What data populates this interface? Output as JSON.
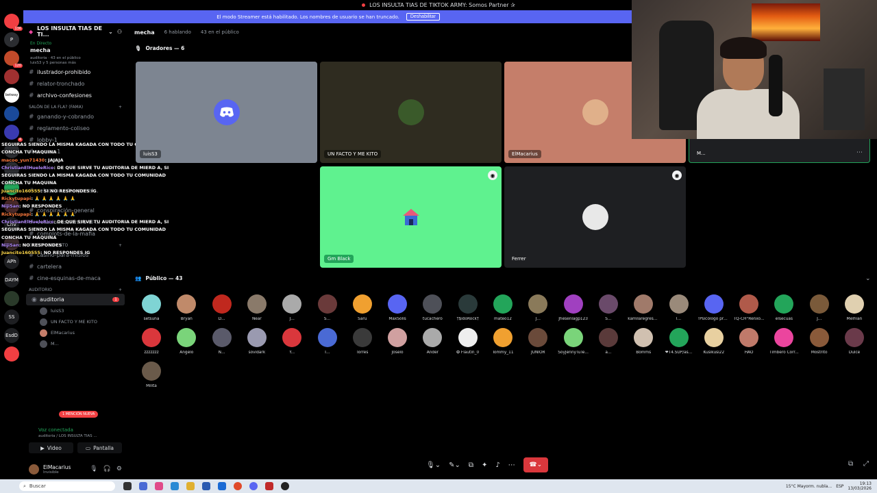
{
  "window": {
    "title": "LOS INSULTA TIAS DE TIKTOK ARMY: Somos Partner ✰"
  },
  "streamer_banner": {
    "text": "El modo Streamer está habilitado. Los nombres de usuario se han truncado.",
    "button": "Deshabilitar"
  },
  "rail": {
    "items": [
      {
        "label": "NUEVO",
        "badge": "136"
      },
      {
        "label": "P",
        "badge": ""
      },
      {
        "label": "",
        "badge": "120"
      },
      {
        "label": "",
        "badge": ""
      },
      {
        "label": "betway",
        "badge": ""
      },
      {
        "label": "",
        "badge": ""
      },
      {
        "label": "",
        "badge": "4"
      },
      {
        "label": "",
        "badge": ""
      }
    ]
  },
  "sidebar": {
    "server_name": "LOS INSULTA TIAS DE TI...",
    "live": {
      "tag": "En Directo",
      "name": "mecha",
      "meta1": "auditoria · 43 en el público",
      "meta2": "luisS3 y 5 personas más"
    },
    "channels_top": [
      {
        "label": "ilustrador-prohibido",
        "bright": true
      },
      {
        "label": "relator-tronchado",
        "bright": false
      },
      {
        "label": "archivo-confesiones",
        "bright": true
      }
    ],
    "category_fama": "SALÓN DE LA FLA? (FAMA)",
    "channels_fama": [
      {
        "label": "ganando-y-cobrando"
      },
      {
        "label": "reglamento-coliseo"
      },
      {
        "label": "lobby-1"
      },
      {
        "label": "versus-1"
      },
      {
        "label": "seleccionados-por-el..."
      }
    ],
    "channels_mid": [
      {
        "label": "conspiración-general"
      },
      {
        "label": "votaciones-contra-el-..."
      },
      {
        "label": "complots-de-la-mafia"
      }
    ],
    "category_ent": "ENTRETENIMIENTO",
    "channels_ent": [
      {
        "label": "casino-para-misios"
      },
      {
        "label": "cartelera"
      },
      {
        "label": "cine-esquinas-de-maca"
      }
    ],
    "category_aud": "AUDITORIO",
    "voice_channel": {
      "label": "auditoria",
      "sub": "mecha",
      "count": "1"
    },
    "voice_users": [
      "luisS3",
      "UN FACTO Y ME KITO",
      "ElMacarius",
      "M..."
    ],
    "mention_badge": "1 MENCIÓN NUEVA"
  },
  "voice_bar": {
    "status": "Voz conectada",
    "path": "auditoria / LOS INSULTA TIAS ...",
    "video": "Video",
    "screen": "Pantalla"
  },
  "user_bar": {
    "name": "ElMacarius",
    "status": "Invisible"
  },
  "chat_overlay": [
    {
      "user": "",
      "text": "SEGUIRAS SIENDO LA MISMA KAGADA CON TODO TU COMUNIDAD CONCHA TU MAQUINA"
    },
    {
      "user": "macoo_yun71430",
      "text": ": JAJAJA"
    },
    {
      "user": "ChristianElHueleRico",
      "text": ": DE QUE SIRVE TU AUDITORIA DE MIERD A, SI SEGUIRAS SIENDO LA MISMA KAGADA CON TODO TU COMUNIDAD CONCHA TU MAQUINA"
    },
    {
      "user": "Juancito160555",
      "text": ": SI NO RESPONDES IG"
    },
    {
      "user": "Rickytupapi",
      "text": ": 🙏 🙏 🙏 🙏 🙏 🙏"
    },
    {
      "user": "NijiSan",
      "text": ": NO RESPONDES"
    },
    {
      "user": "Rickytupapi",
      "text": ": 🙏 🙏 🙏 🙏 🙏 🙏"
    },
    {
      "user": "ChristianElHueleRico",
      "text": ": DE QUE SIRVE TU AUDITORIA DE MIERD A, SI SEGUIRAS SIENDO LA MISMA KAGADA CON TODO TU COMUNIDAD CONCHA TU MAQUINA"
    },
    {
      "user": "NijiSan",
      "text": ": NO RESPONDES"
    },
    {
      "user": "Juancito160555",
      "text": ": NO RESPONDES IG"
    }
  ],
  "main": {
    "channel": "mecha",
    "talking": "6 hablando",
    "audience_count": "43 en el público",
    "speakers_title": "Oradores — 6",
    "public_title": "Público — 43",
    "speakers": [
      {
        "label": "luisS3",
        "color": "#7d8591",
        "icon": "discord"
      },
      {
        "label": "UN FACTO Y ME KITO",
        "color": "#2f2c20",
        "icon": "avatar"
      },
      {
        "label": "ElMacarius",
        "color": "#c57e6a",
        "icon": "avatar"
      },
      {
        "label": "M...",
        "color": "#1e1f22",
        "icon": ""
      },
      {
        "label": "Gm Black",
        "color": "#5ff28f",
        "icon": "house"
      },
      {
        "label": "Ferrer",
        "color": "#1e1f22",
        "icon": "avatar"
      }
    ],
    "audience": [
      {
        "name": "setsuna",
        "color": "#7fd4d4"
      },
      {
        "name": "Bryan",
        "color": "#c08a6a"
      },
      {
        "name": "D...",
        "color": "#c0281e"
      },
      {
        "name": "Near",
        "color": "#8a7a6a"
      },
      {
        "name": "J...",
        "color": "#aaaaaa"
      },
      {
        "name": "S...",
        "color": "#6a3a3a"
      },
      {
        "name": "Saru",
        "color": "#f0a030"
      },
      {
        "name": "MaxSolis",
        "color": "#5865f2"
      },
      {
        "name": "tucachero",
        "color": "#4e5058"
      },
      {
        "name": "†$idoRock†",
        "color": "#2a3a3a"
      },
      {
        "name": "mateo12",
        "color": "#23a55a"
      },
      {
        "name": "J...",
        "color": "#8a7a5a"
      },
      {
        "name": "Jhesenlagp123",
        "color": "#a040c0"
      },
      {
        "name": "S...",
        "color": "#6a4a6a"
      },
      {
        "name": "kamilaregresa...",
        "color": "#a07a6a"
      },
      {
        "name": "I...",
        "color": "#9a8a7a"
      },
      {
        "name": "!Psicologo pro...",
        "color": "#5865f2"
      },
      {
        "name": "TQ-CH°Renxo...",
        "color": "#b05a4a"
      },
      {
        "name": "elsecuas",
        "color": "#23a55a"
      },
      {
        "name": "J...",
        "color": "#7a5a3a"
      },
      {
        "name": "Melhian",
        "color": "#e0d0b0"
      },
      {
        "name": "zzzzzzz",
        "color": "#da373c"
      },
      {
        "name": "Angelo",
        "color": "#7ad47a"
      },
      {
        "name": "N...",
        "color": "#5a5a6a"
      },
      {
        "name": "sovidark",
        "color": "#9a9ab0"
      },
      {
        "name": "Y...",
        "color": "#da373c"
      },
      {
        "name": "T...",
        "color": "#4a6ad4"
      },
      {
        "name": "Torres",
        "color": "#3a3a3a"
      },
      {
        "name": "Joselo",
        "color": "#d0a0a0"
      },
      {
        "name": "Ander",
        "color": "#aaaaaa"
      },
      {
        "name": "✪ Flautin_0",
        "color": "#eeeeee"
      },
      {
        "name": "Tommy_11",
        "color": "#f0a030"
      },
      {
        "name": "JUNIOR",
        "color": "#6a4a3a"
      },
      {
        "name": "SoyJennyTuTe...",
        "color": "#7ad47a"
      },
      {
        "name": "a...",
        "color": "#5a3a3a"
      },
      {
        "name": "Bomms",
        "color": "#d0c0b0"
      },
      {
        "name": "❤T4.SUP/as...",
        "color": "#23a55a"
      },
      {
        "name": "Kusikusi22",
        "color": "#e8d0a0"
      },
      {
        "name": "HAO",
        "color": "#c07a6a"
      },
      {
        "name": "Timbero Corr...",
        "color": "#eb459e"
      },
      {
        "name": "Mostrito",
        "color": "#8a5a3a"
      },
      {
        "name": "Dulce",
        "color": "#6a3a4a"
      },
      {
        "name": "Milita",
        "color": "#6a5a4a"
      }
    ]
  },
  "taskbar": {
    "search": "Buscar",
    "weather": "15°C  Mayorm. nubla...",
    "lang": "ESP",
    "time": "19:13",
    "date": "13/03/2026"
  },
  "colors": {
    "blurple": "#5865f2",
    "green": "#23a55a",
    "red": "#da373c"
  }
}
